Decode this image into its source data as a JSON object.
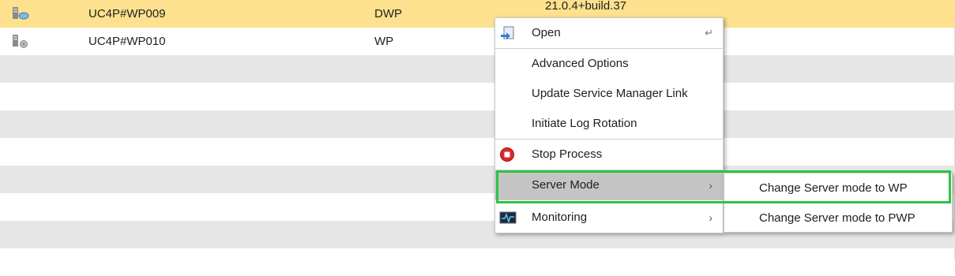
{
  "rows": [
    {
      "name": "UC4P#WP009",
      "type": "DWP",
      "version": "21.0.4+build.37",
      "selected": true
    },
    {
      "name": "UC4P#WP010",
      "type": "WP",
      "version": ""
    }
  ],
  "context_menu": {
    "open": {
      "label": "Open",
      "hint": "↵"
    },
    "advanced_options": {
      "label": "Advanced Options"
    },
    "update_link": {
      "label": "Update Service Manager Link"
    },
    "log_rotation": {
      "label": "Initiate Log Rotation"
    },
    "stop_process": {
      "label": "Stop Process"
    },
    "server_mode": {
      "label": "Server Mode",
      "arrow": "›"
    },
    "monitoring": {
      "label": "Monitoring",
      "arrow": "›"
    }
  },
  "submenu": {
    "items": [
      {
        "label": "Change Server mode to WP"
      },
      {
        "label": "Change Server mode to PWP"
      }
    ]
  },
  "colors": {
    "selected_row": "#fde18e",
    "alt_row": "#e6e6e6",
    "menu_highlight": "#c4c4c4",
    "outline": "#2fc345"
  }
}
